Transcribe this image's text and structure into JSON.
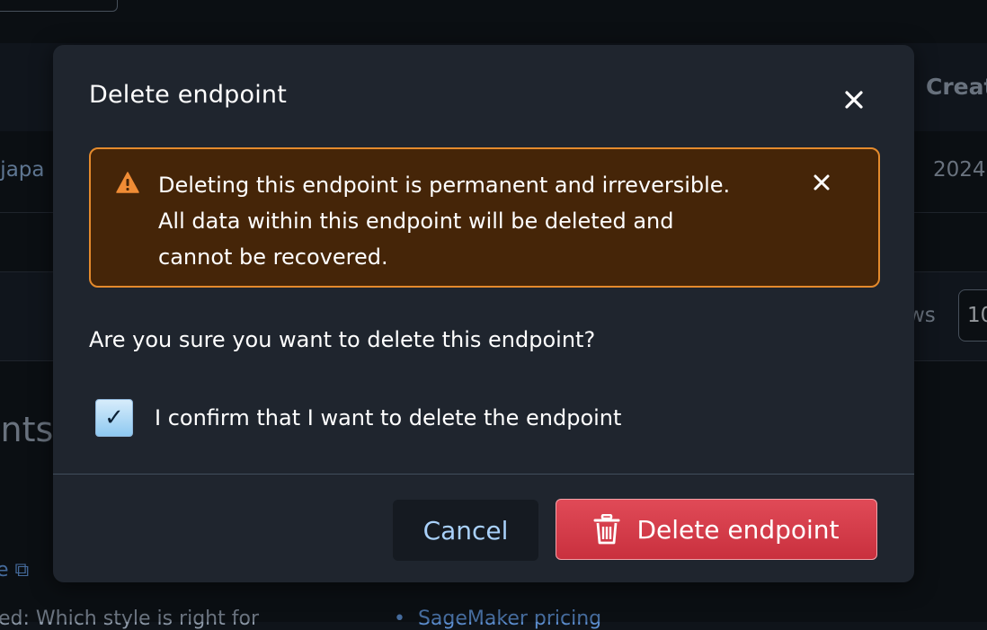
{
  "background": {
    "column_header_partial": "Creat",
    "row_name_partial": "-japa",
    "row_date_partial": "2024",
    "rows_label_partial": "ws",
    "rows_value_partial": "10",
    "section_heading_partial": "ints",
    "link_partial_e": "e",
    "bottom_text_partial": "ed: Which style is right for",
    "bottom_link_pricing": "SageMaker pricing"
  },
  "modal": {
    "title": "Delete endpoint",
    "close_icon": "close-icon",
    "alert": {
      "icon": "warning-triangle-icon",
      "text": "Deleting this endpoint is permanent and irreversible. All data within this endpoint will be deleted and cannot be recovered.",
      "color_background": "#452508",
      "color_border": "#e48a2c"
    },
    "question": "Are you sure you want to delete this endpoint?",
    "confirm": {
      "checked": true,
      "check_glyph": "✓",
      "label": "I confirm that I want to delete the endpoint"
    },
    "buttons": {
      "cancel_label": "Cancel",
      "delete_label": "Delete endpoint",
      "delete_icon": "trash-icon",
      "color_delete": "#d63b48"
    }
  }
}
